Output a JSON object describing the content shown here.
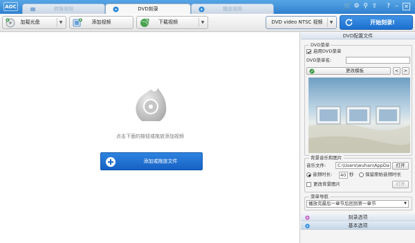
{
  "app": {
    "logo": "AOC"
  },
  "tabs": [
    {
      "label": "转换视频",
      "active": false
    },
    {
      "label": "DVD刻录",
      "active": true
    },
    {
      "label": "播放视频",
      "active": false
    }
  ],
  "toolbar": {
    "load_disc": "加载光盘",
    "add_video": "添加视频",
    "download_video": "下载视频",
    "format": "DVD video NTSC 视频",
    "start_burn": "开始刻录!"
  },
  "main": {
    "hint": "点击下面的按钮或拖放添加视频",
    "add_button": "添加或拖放文件"
  },
  "side": {
    "header": "DVD配置文件",
    "menu_group": "DVD菜单",
    "enable_menu": "启用DVD菜单",
    "enable_menu_checked": true,
    "menu_name_label": "DVD菜单名:",
    "menu_name_value": "",
    "change_template": "更改模板",
    "prev": "<",
    "next": ">",
    "bg_group": "背景音乐和图片",
    "audio_label": "音乐文件:",
    "audio_path": "C:\\Users\\wuhan\\AppDa",
    "open": "打开",
    "duration_label": "音频时长:",
    "duration_value": "40",
    "seconds": "秒",
    "keep_original": "保留原始音频时长",
    "change_bg": "更改背景图片",
    "change_bg_checked": false,
    "open2": "打开",
    "nav_group": "菜单导航",
    "nav_value": "播放完最后一章节后回到第一章节",
    "burn_options": "刻录选项",
    "basic_options": "基本选项"
  },
  "colors": {
    "accent": "#2f80cf",
    "add_button": "#1f6fd0",
    "burn_button": "#1c70cf"
  }
}
